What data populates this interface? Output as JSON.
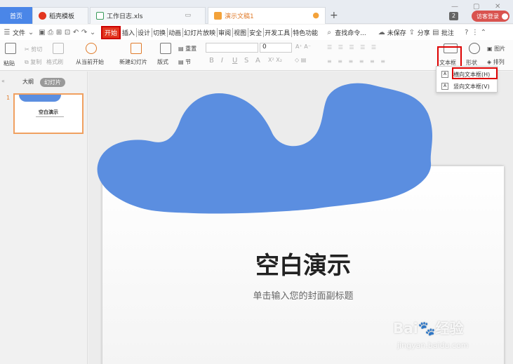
{
  "tabs": {
    "home": "首页",
    "template": "稻壳模板",
    "excel": "工作日志.xls",
    "ppt": "演示文稿1",
    "count": "2",
    "login": "访客登录"
  },
  "menu": {
    "file": "文件",
    "items": [
      "开始",
      "插入",
      "设计",
      "切换",
      "动画",
      "幻灯片放映",
      "审阅",
      "视图",
      "安全",
      "开发工具",
      "特色功能"
    ],
    "search": "查找命令...",
    "unsaved": "未保存",
    "share": "分享",
    "comment": "批注"
  },
  "ribbon": {
    "paste": "粘贴",
    "cut": "剪切",
    "copy": "复制",
    "format_painter": "格式刷",
    "play_from_current": "从当前开始",
    "new_slide": "新建幻灯片",
    "layout": "版式",
    "reset": "重置",
    "section": "节",
    "font_size": "0",
    "textbox": "文本框",
    "shape": "形状",
    "picture": "图片",
    "arrange": "排列"
  },
  "dropdown": {
    "horizontal": "横向文本框(H)",
    "vertical": "竖向文本框(V)"
  },
  "panel": {
    "outline": "大纲",
    "slides": "幻灯片",
    "slide_number": "1",
    "thumb_title": "空白演示"
  },
  "slide": {
    "title": "空白演示",
    "subtitle": "单击输入您的封面副标题",
    "shape_color": "#5b8ee0"
  },
  "watermark": {
    "brand": "Bai",
    "brand2": "经验",
    "url": "jingyan.baidu.com"
  }
}
